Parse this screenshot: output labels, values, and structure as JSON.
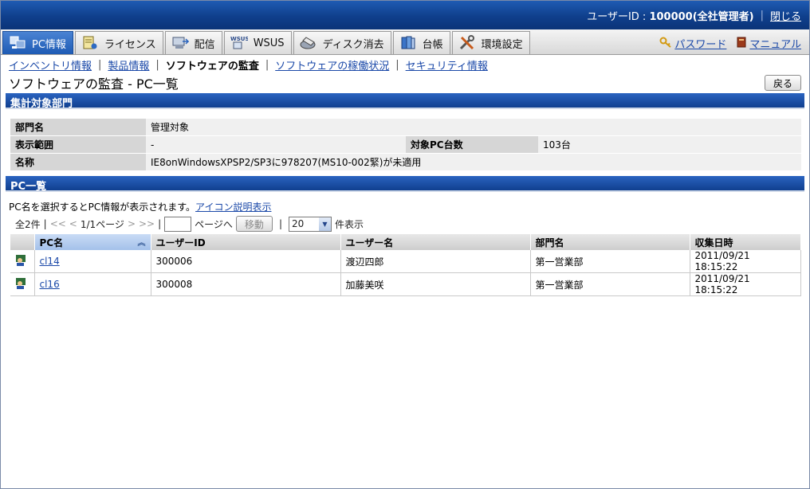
{
  "header": {
    "user_prefix": "ユーザーID : ",
    "user_id_text": "100000(全社管理者)",
    "close_label": "閉じる"
  },
  "tabs": [
    {
      "label": "PC情報",
      "icon": "pc-info-icon",
      "active": true
    },
    {
      "label": "ライセンス",
      "icon": "license-icon",
      "active": false
    },
    {
      "label": "配信",
      "icon": "delivery-icon",
      "active": false
    },
    {
      "label": "WSUS",
      "icon": "wsus-icon",
      "active": false
    },
    {
      "label": "ディスク消去",
      "icon": "disk-erase-icon",
      "active": false
    },
    {
      "label": "台帳",
      "icon": "ledger-icon",
      "active": false
    },
    {
      "label": "環境設定",
      "icon": "settings-tools-icon",
      "active": false
    }
  ],
  "toplinks": {
    "password": "パスワード",
    "manual": "マニュアル"
  },
  "subnav": {
    "inventory": "インベントリ情報",
    "product": "製品情報",
    "audit": "ソフトウェアの監査",
    "usage": "ソフトウェアの稼働状況",
    "security": "セキュリティ情報"
  },
  "page": {
    "title": "ソフトウェアの監査 - PC一覧",
    "back_label": "戻る"
  },
  "section1": {
    "title": "集計対象部門",
    "dept_label": "部門名",
    "dept_value": "管理対象",
    "range_label": "表示範囲",
    "range_value": "-",
    "count_label": "対象PC台数",
    "count_value": "103台",
    "name_label": "名称",
    "name_value": "IE8onWindowsXPSP2/SP3に978207(MS10-002緊)が未適用"
  },
  "section2": {
    "title": "PC一覧",
    "note": "PC名を選択するとPC情報が表示されます。",
    "icon_link": "アイコン説明表示"
  },
  "pager": {
    "total": "全2件",
    "first": "<<",
    "prev": "<",
    "page": "1/1ページ",
    "next": ">",
    "last": ">>",
    "goto": "ページへ",
    "move": "移動",
    "per_page": "20",
    "per_page_suffix": "件表示"
  },
  "grid": {
    "headers": [
      "PC名",
      "ユーザーID",
      "ユーザー名",
      "部門名",
      "収集日時"
    ],
    "rows": [
      {
        "pc": "cl14",
        "uid": "300006",
        "uname": "渡辺四郎",
        "dept": "第一営業部",
        "date": "2011/09/21 18:15:22"
      },
      {
        "pc": "cl16",
        "uid": "300008",
        "uname": "加藤美咲",
        "dept": "第一営業部",
        "date": "2011/09/21 18:15:22"
      }
    ]
  }
}
